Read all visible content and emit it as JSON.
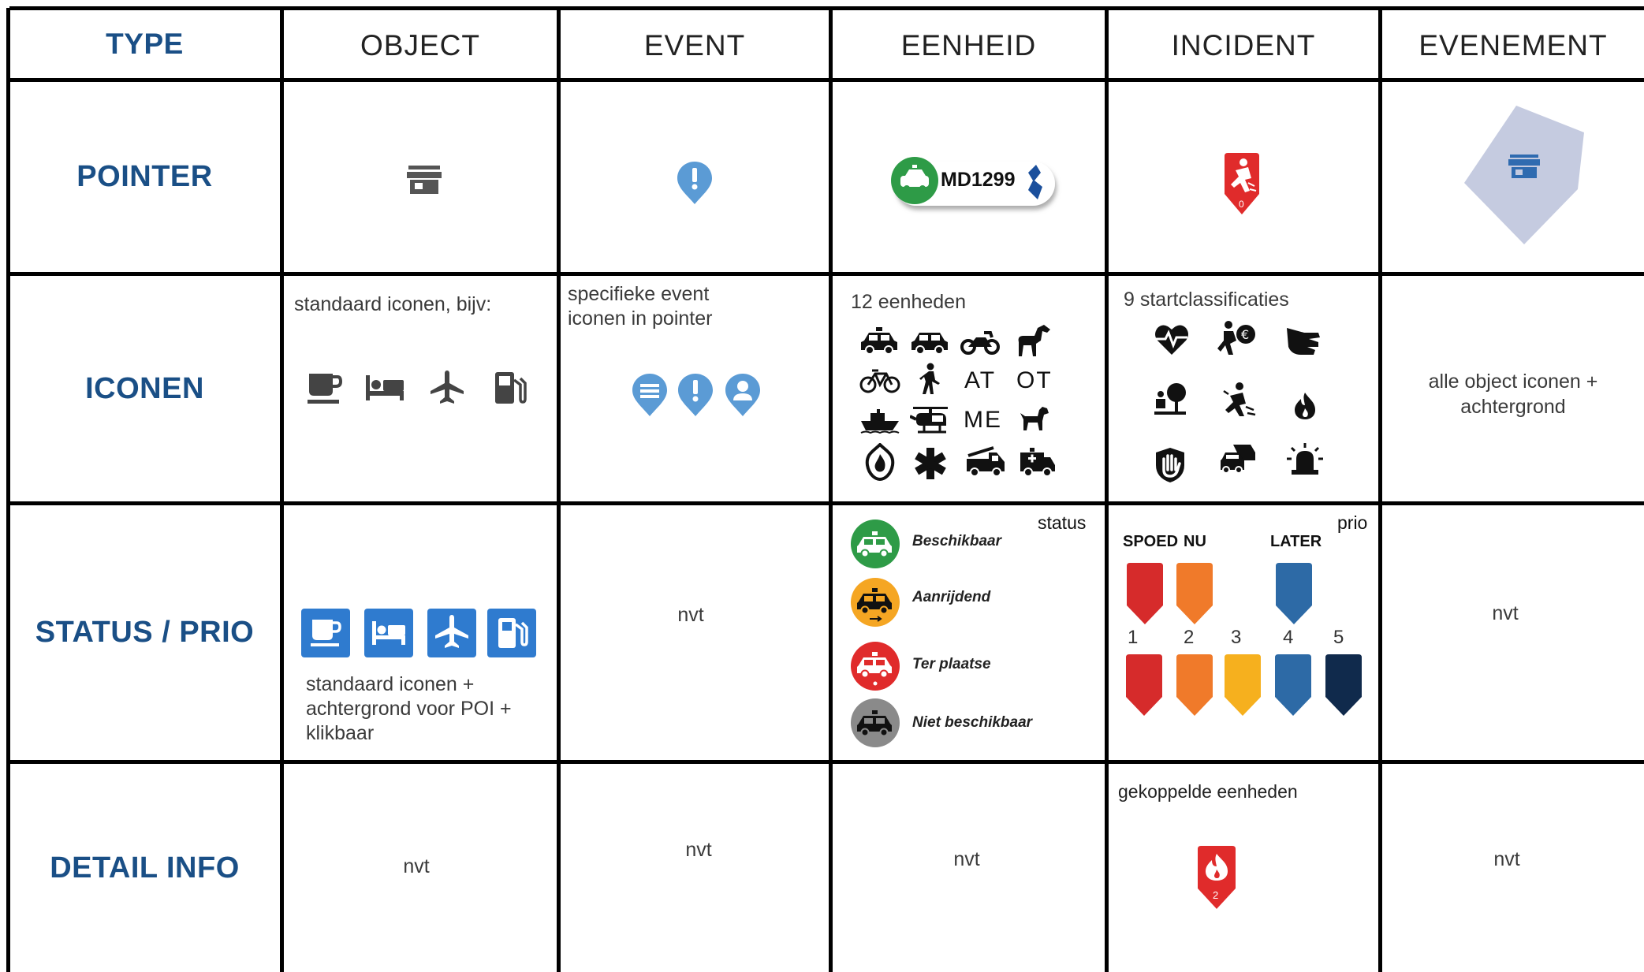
{
  "header": {
    "type_label": "TYPE",
    "columns": [
      "OBJECT",
      "EVENT",
      "EENHEID",
      "INCIDENT",
      "EVENEMENT"
    ]
  },
  "rows": {
    "pointer": "POINTER",
    "iconen": "ICONEN",
    "status": "STATUS / PRIO",
    "detail": "DETAIL INFO"
  },
  "pointer": {
    "eenheid_code": "MD1299",
    "incident_number": "0"
  },
  "iconen": {
    "object_caption": "standaard iconen, bijv:",
    "event_caption_line1": "specifieke event",
    "event_caption_line2": "iconen in pointer",
    "eenheid_caption": "12 eenheden",
    "eenheid_text_icons": [
      "AT",
      "OT",
      "ME"
    ],
    "incident_caption": "9 startclassificaties",
    "evenement_line1": "alle object iconen +",
    "evenement_line2": "achtergrond"
  },
  "status": {
    "object_line1": "standaard iconen +",
    "object_line2": "achtergrond voor POI +",
    "object_line3": "klikbaar",
    "event_value": "nvt",
    "eenheid_caption": "status",
    "eenheid_states": [
      "Beschikbaar",
      "Aanrijdend",
      "Ter plaatse",
      "Niet beschikbaar"
    ],
    "incident_caption": "prio",
    "incident_top_labels": [
      "SPOED",
      "NU",
      "LATER"
    ],
    "incident_numbers": [
      "1",
      "2",
      "3",
      "4",
      "5"
    ],
    "evenement_value": "nvt"
  },
  "detail": {
    "object_value": "nvt",
    "event_value": "nvt",
    "eenheid_value": "nvt",
    "incident_caption": "gekoppelde eenheden",
    "incident_number": "2",
    "evenement_value": "nvt"
  },
  "colors": {
    "heading_blue": "#1a4f86",
    "poi_blue": "#2f7bcf",
    "event_blue": "#5b9bd5",
    "green": "#2e9b47",
    "orange": "#f5a623",
    "red": "#e02b2b",
    "gray": "#8a8a8a",
    "prio_red": "#d62b2b",
    "prio_orange": "#f07a2a",
    "prio_yellow": "#f6b01e",
    "prio_blue": "#2d6aa6",
    "prio_navy": "#102a4c",
    "evenement_shape": "#c5cbe0"
  }
}
